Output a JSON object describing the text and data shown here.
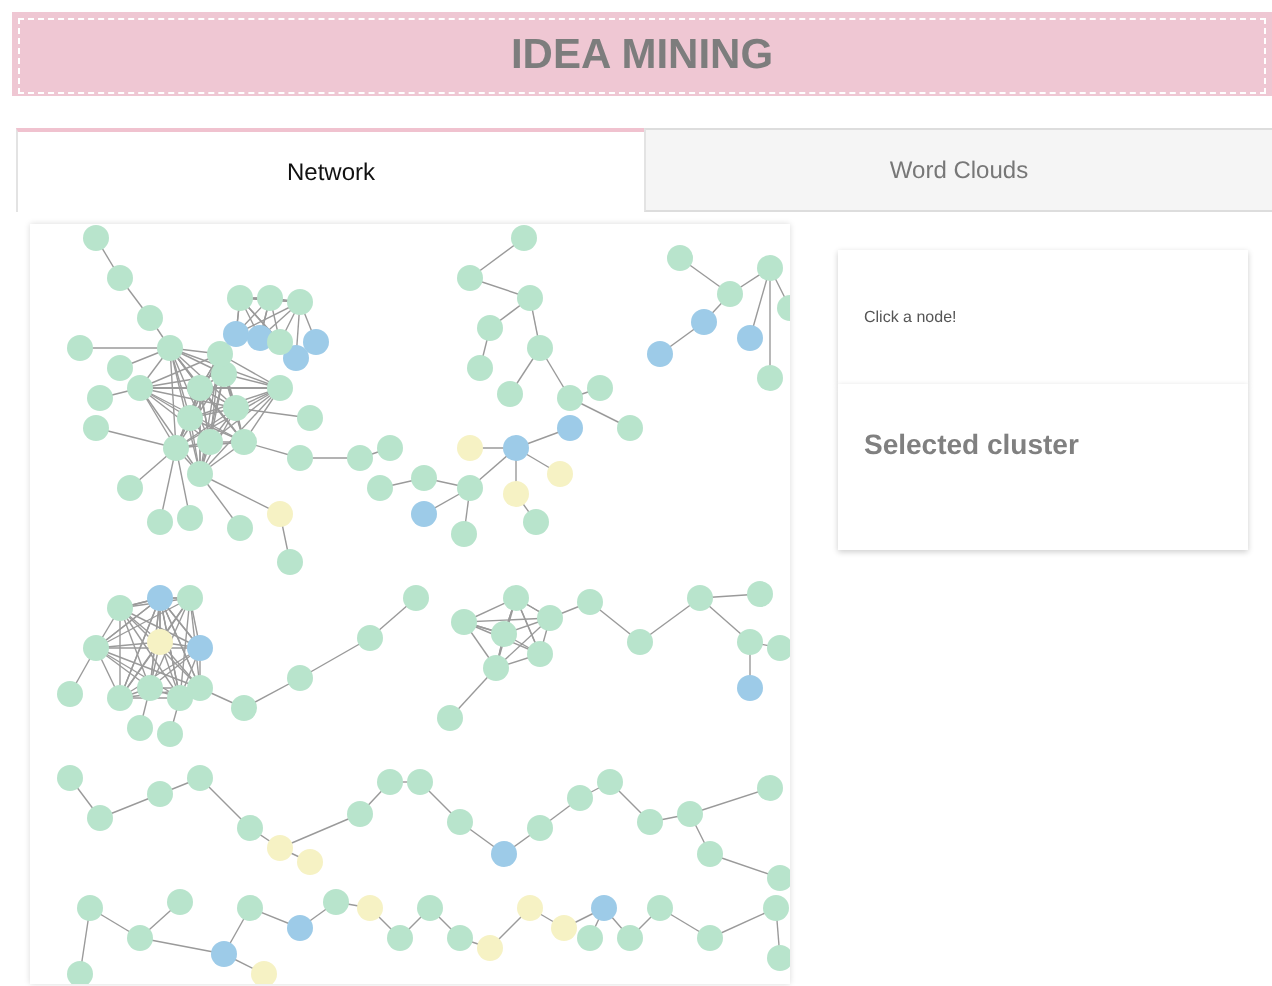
{
  "header": {
    "title": "IDEA MINING"
  },
  "tabs": [
    {
      "label": "Network",
      "selected": true
    },
    {
      "label": "Word Clouds",
      "selected": false
    }
  ],
  "info_card": {
    "text": "Click a node!"
  },
  "cluster_card": {
    "title": "Selected cluster"
  }
}
